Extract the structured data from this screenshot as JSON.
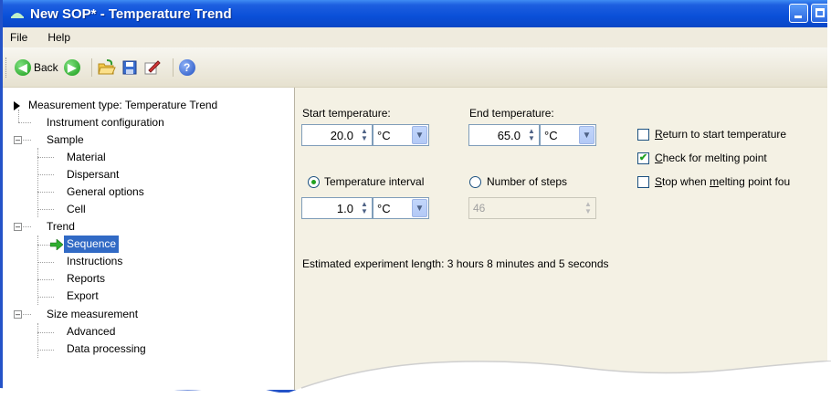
{
  "window": {
    "title": "New SOP* - Temperature Trend"
  },
  "menu": [
    "File",
    "Help"
  ],
  "toolbar": {
    "back_label": "Back"
  },
  "tree": {
    "items": [
      {
        "label": "Measurement type: Temperature Trend"
      },
      {
        "label": "Instrument configuration"
      },
      {
        "label": "Sample"
      },
      {
        "label": "Material"
      },
      {
        "label": "Dispersant"
      },
      {
        "label": "General options"
      },
      {
        "label": "Cell"
      },
      {
        "label": "Trend"
      },
      {
        "label": "Sequence"
      },
      {
        "label": "Instructions"
      },
      {
        "label": "Reports"
      },
      {
        "label": "Export"
      },
      {
        "label": "Size measurement"
      },
      {
        "label": "Advanced"
      },
      {
        "label": "Data processing"
      }
    ]
  },
  "form": {
    "start_label": "Start temperature:",
    "start_value": "20.0",
    "start_unit": "°C",
    "end_label": "End temperature:",
    "end_value": "65.0",
    "end_unit": "°C",
    "interval_label": "Temperature interval",
    "interval_value": "1.0",
    "interval_unit": "°C",
    "steps_label": "Number of steps",
    "steps_value": "46",
    "return_first": "R",
    "return_rest": "eturn to start temperature",
    "melting_first": "C",
    "melting_rest": "heck for melting point",
    "stop_first": "S",
    "stop_mid": "top when ",
    "stop_u2": "m",
    "stop_rest": "elting point fou",
    "estimate": "Estimated experiment length:  3 hours 8 minutes and 5 seconds"
  },
  "colors": {
    "titlebar": "#0a4fd8",
    "selection": "#316ac5",
    "panel": "#f4f1e4"
  }
}
